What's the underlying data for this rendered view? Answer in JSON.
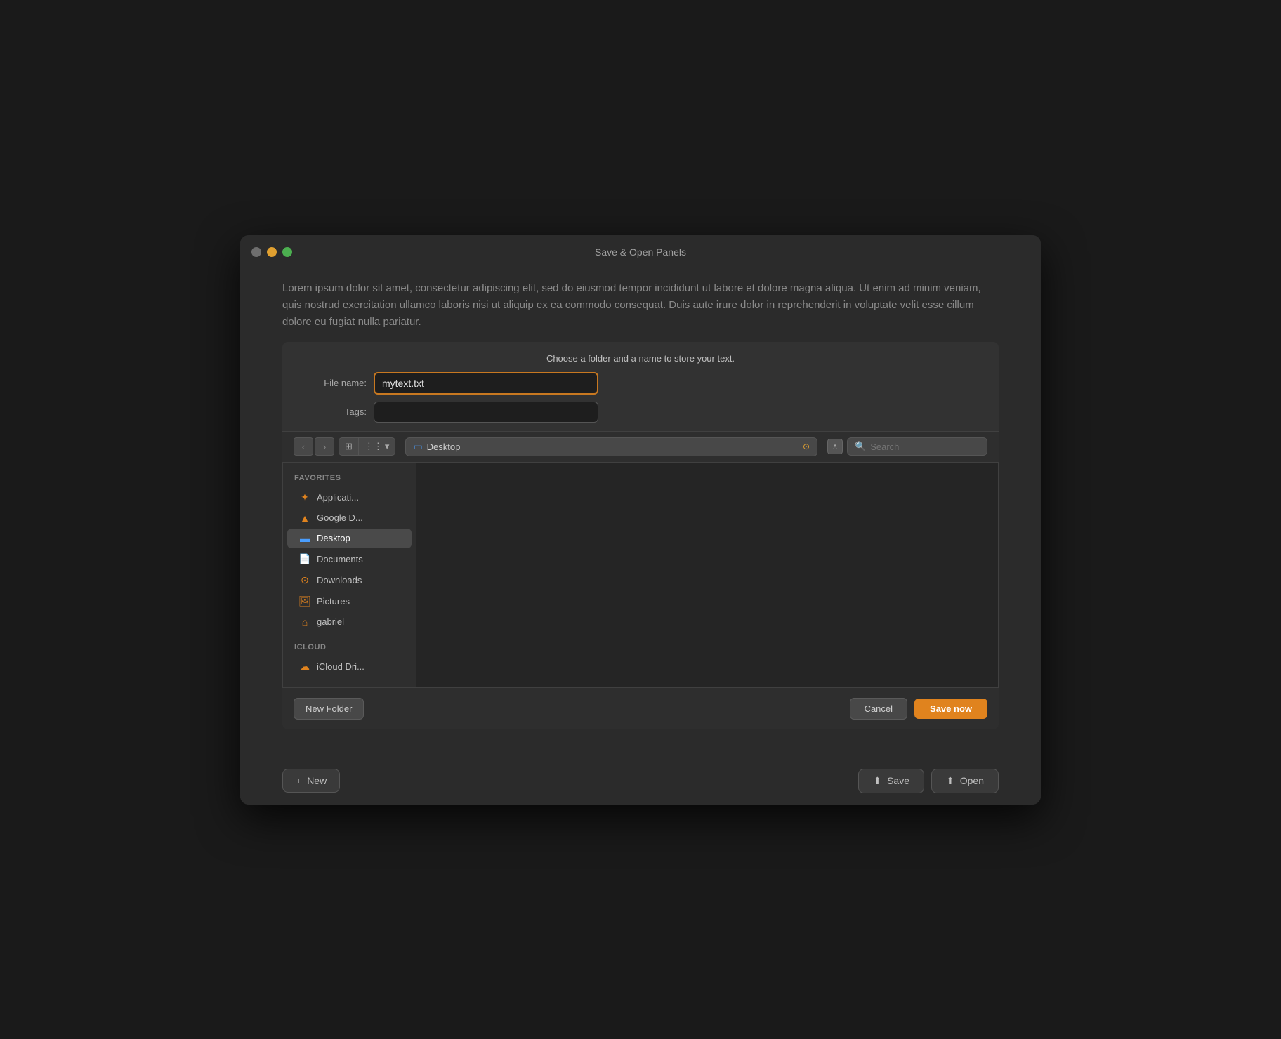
{
  "window": {
    "title": "Save & Open Panels",
    "controls": {
      "close": "close",
      "minimize": "minimize",
      "maximize": "maximize"
    }
  },
  "lorem": {
    "text": "Lorem ipsum dolor sit amet, consectetur adipiscing elit, sed do eiusmod tempor incididunt ut labore et dolore magna aliqua. Ut enim ad minim veniam, quis nostrud exercitation ullamco laboris nisi ut aliquip ex ea commodo consequat. Duis aute irure dolor in reprehenderit in voluptate velit esse cillum dolore eu fugiat nulla pariatur."
  },
  "dialog": {
    "header": "Choose a folder and a name to store your text.",
    "file_name_label": "File name:",
    "file_name_value": "mytext.txt",
    "tags_label": "Tags:",
    "tags_placeholder": "",
    "search_placeholder": "Search",
    "location": "Desktop",
    "nav_back": "‹",
    "nav_forward": "›"
  },
  "sidebar": {
    "favorites_label": "Favorites",
    "icloud_label": "iCloud",
    "items": [
      {
        "id": "applications",
        "label": "Applicati...",
        "icon": "✦",
        "icon_class": "icon-orange"
      },
      {
        "id": "google-drive",
        "label": "Google D...",
        "icon": "▲",
        "icon_class": "icon-orange"
      },
      {
        "id": "desktop",
        "label": "Desktop",
        "icon": "▭",
        "icon_class": "icon-blue",
        "active": true
      },
      {
        "id": "documents",
        "label": "Documents",
        "icon": "📄",
        "icon_class": "icon-yellow"
      },
      {
        "id": "downloads",
        "label": "Downloads",
        "icon": "⊙",
        "icon_class": "icon-orange"
      },
      {
        "id": "pictures",
        "label": "Pictures",
        "icon": "🖼",
        "icon_class": "icon-orange"
      },
      {
        "id": "gabriel",
        "label": "gabriel",
        "icon": "⌂",
        "icon_class": "icon-orange"
      }
    ],
    "icloud_items": [
      {
        "id": "icloud-drive",
        "label": "iCloud Dri...",
        "icon": "☁",
        "icon_class": "icon-cloud"
      }
    ]
  },
  "toolbar": {
    "view_columns_label": "⊞",
    "view_grid_label": "⊟",
    "expand_label": "∧"
  },
  "footer": {
    "new_folder_label": "New Folder",
    "cancel_label": "Cancel",
    "save_now_label": "Save now"
  },
  "bottom_bar": {
    "new_label": "New",
    "new_icon": "+",
    "save_label": "Save",
    "save_icon": "⬆",
    "open_label": "Open",
    "open_icon": "⬆"
  }
}
